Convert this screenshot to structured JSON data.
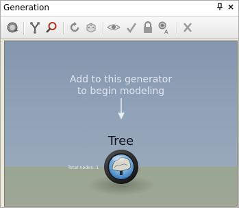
{
  "panel": {
    "title": "Generation",
    "pin_glyph": "⌂",
    "close_glyph": "×"
  },
  "toolbar": {
    "buttons": [
      {
        "name": "add-node-icon"
      },
      {
        "name": "branch-icon"
      },
      {
        "name": "magnifier-icon"
      },
      {
        "name": "cycle-icon"
      },
      {
        "name": "random-dice-icon"
      },
      {
        "name": "eye-icon"
      },
      {
        "name": "check-icon"
      },
      {
        "name": "lock-icon"
      },
      {
        "name": "parameters-icon"
      },
      {
        "name": "remove-x-icon"
      }
    ]
  },
  "viewport": {
    "hint_line1": "Add to this generator",
    "hint_line2": "to begin modeling",
    "node_label": "Tree",
    "total_nodes": "Total nodes: 1"
  }
}
